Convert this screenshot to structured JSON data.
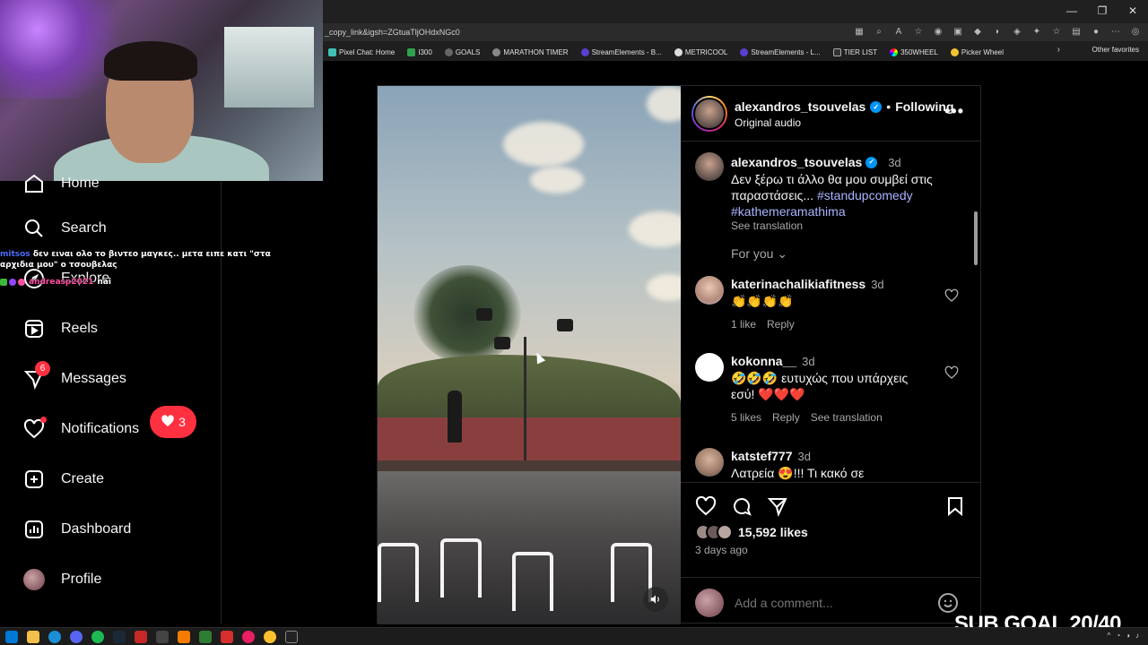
{
  "browser": {
    "url": "_copy_link&igsh=ZGtuaTljOHdxNGc0",
    "bookmarks": [
      "Pixel Chat: Home",
      "I300",
      "GOALS",
      "MARATHON TIMER",
      "StreamElements - B...",
      "METRICOOL",
      "StreamElements - L...",
      "TIER LIST",
      "350WHEEL",
      "Picker Wheel"
    ],
    "other_favorites": "Other favorites"
  },
  "chat": {
    "user1": "mitsos",
    "msg1": "δεν ειναι ολο το βιντεο μαγκες.. μετα ειπε κατι \"στα αρχιδια μου\" ο τσουβελας",
    "user2": "andreasp2021",
    "msg2": "nai"
  },
  "nav": {
    "home": "Home",
    "search": "Search",
    "explore": "Explore",
    "reels": "Reels",
    "messages": "Messages",
    "messages_badge": "6",
    "notifications": "Notifications",
    "notifications_count": "3",
    "create": "Create",
    "dashboard": "Dashboard",
    "profile": "Profile"
  },
  "post": {
    "author": "alexandros_tsouvelas",
    "separator": "•",
    "follow_state": "Following",
    "audio": "Original audio",
    "caption_time": "3d",
    "caption_text": "Δεν ξέρω τι άλλο θα μου συμβεί στις παραστάσεις...",
    "hashtag1": "#standupcomedy",
    "hashtag2": "#kathemeramathima",
    "see_translation": "See translation",
    "for_you": "For you",
    "comments": [
      {
        "user": "katerinachalikiafitness",
        "time": "3d",
        "text": "👏👏👏👏",
        "likes": "1 like",
        "reply": "Reply",
        "translation": ""
      },
      {
        "user": "kokonna__",
        "time": "3d",
        "text": "🤣🤣🤣 ευτυχώς που υπάρχεις εσύ! ❤️❤️❤️",
        "likes": "5 likes",
        "reply": "Reply",
        "translation": "See translation"
      },
      {
        "user": "katstef777",
        "time": "3d",
        "text": "Λατρεία 😍!!! Τι κακό σε",
        "likes": "",
        "reply": "",
        "translation": ""
      }
    ],
    "likes_count": "15,592 likes",
    "posted": "3 days ago",
    "add_comment_placeholder": "Add a comment..."
  },
  "overlay": {
    "sub_goal": "SUB GOAL 20/40"
  },
  "colors": {
    "accent_blue": "#0095f6",
    "hashtag": "#a8b5ff",
    "badge_red": "#ff3040",
    "muted_text": "#a8a8a8"
  }
}
